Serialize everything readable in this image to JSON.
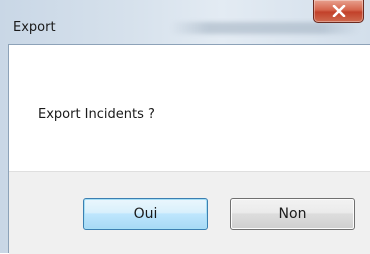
{
  "window": {
    "title": "Export",
    "close_icon": "close-icon"
  },
  "dialog": {
    "message": "Export Incidents ?"
  },
  "buttons": {
    "yes_label": "Oui",
    "no_label": "Non"
  },
  "colors": {
    "close_button": "#c2412a",
    "default_button_border": "#3c7fb1",
    "footer_background": "#f0f0f0"
  }
}
